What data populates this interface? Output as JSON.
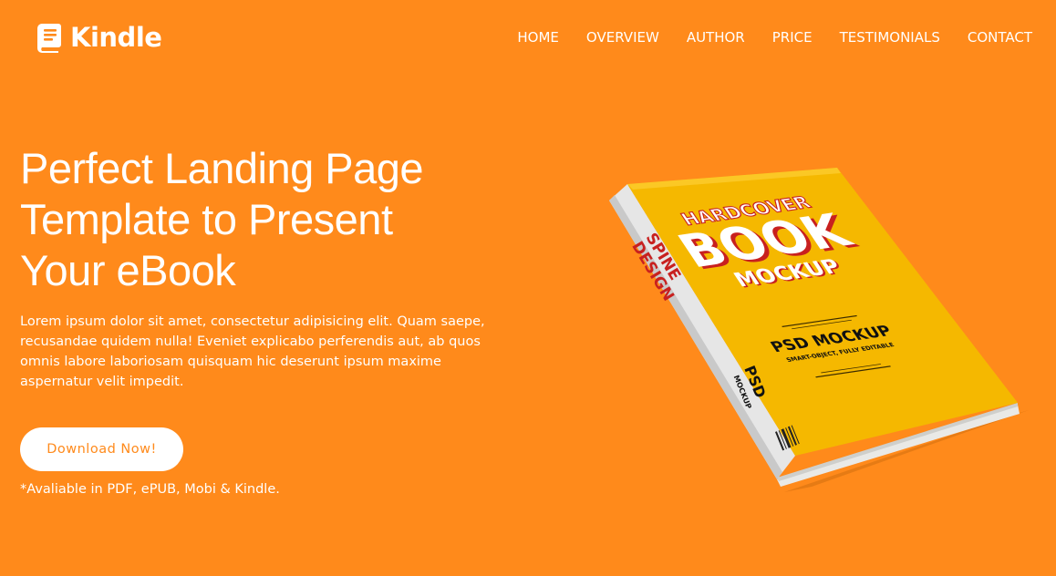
{
  "brand": {
    "name": "Kindle",
    "icon": "book-icon"
  },
  "nav": {
    "items": [
      {
        "label": "HOME"
      },
      {
        "label": "OVERVIEW"
      },
      {
        "label": "AUTHOR"
      },
      {
        "label": "PRICE"
      },
      {
        "label": "TESTIMONIALS"
      },
      {
        "label": "CONTACT"
      }
    ]
  },
  "hero": {
    "title_lines": [
      "Perfect Landing Page",
      "Template to Present",
      "Your eBook"
    ],
    "description": "Lorem ipsum dolor sit amet, consectetur adipisicing elit. Quam saepe, recusandae quidem nulla! Eveniet explicabo perferendis aut, ab quos omnis labore laboriosam quisquam hic deserunt ipsum maxime aspernatur velit impedit.",
    "cta_label": "Download Now!",
    "availability": "*Avaliable in PDF, ePUB, Mobi & Kindle."
  },
  "book": {
    "cover_top": "HARDCOVER",
    "cover_main": "BOOK",
    "cover_sub": "MOCKUP",
    "cover_tag": "PSD MOCKUP",
    "cover_tagline": "SMART-OBJECT, FULLY EDITABLE",
    "spine_line1": "SPINE",
    "spine_line2": "DESIGN",
    "spine_psd": "PSD",
    "spine_mockup": "MOCKUP"
  },
  "colors": {
    "background": "#ff8a1b",
    "cover": "#f5b800",
    "title_red": "#c8201f",
    "white": "#ffffff"
  }
}
